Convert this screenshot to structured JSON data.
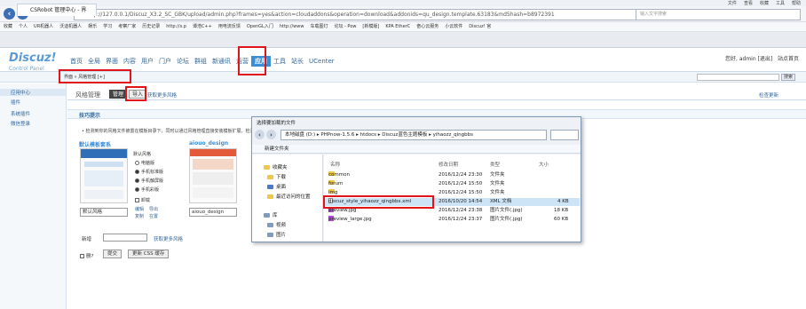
{
  "browser": {
    "menu": [
      "文件",
      "查看",
      "收藏",
      "工具",
      "帮助"
    ],
    "url": "http://127.0.0.1/Discuz_X3.2_SC_GBK/upload/admin.php?frames=yes&action=cloudaddons&operation=download&addonids=qu_design.template.63183&md5hash=b8972391",
    "search_placeholder": "输入文字搜索",
    "bookmarks": [
      "收藏",
      "个人",
      "UR机器人",
      "沃迪机器人",
      "娱乐",
      "学习",
      "考察厂家",
      "历史记录",
      "http://s.p",
      "谭浩C++",
      "用电流反馈",
      "OpenGL入门",
      "http://www",
      "车载图灯",
      "论坛 - Pow",
      "[新模版]",
      "KPA EtherC",
      "奋心云服务",
      "小云软件",
      "Discuz! 官"
    ],
    "tab_title": "CSRobot 管理中心 - 界"
  },
  "header": {
    "logo": "Discuz!",
    "logo_sub": "Control Panel",
    "nav": [
      "首页",
      "全局",
      "界面",
      "内容",
      "用户",
      "门户",
      "论坛",
      "群组",
      "新通讯",
      "运营",
      "应用",
      "工具",
      "站长",
      "UCenter"
    ],
    "active_nav": "应用",
    "user_text": "您好, admin [退出]",
    "site_home": "站点首页"
  },
  "breadcrumb": "界面 » 风格管理 [+]",
  "search_button": "搜索",
  "sidebar": [
    "应用中心",
    "插件",
    "系统插件",
    "微信登录"
  ],
  "main": {
    "title": "风格管理",
    "btn_manage": "管理",
    "btn_import": "导入",
    "more_styles": "获取更多风格",
    "check_new": "检查更新",
    "tip_label": "技巧提示",
    "tip_text": "• 检测到你的风格文件被置在模板目录下，同时以通过风格管理直接安装模板扩展，检测到的风格被置之后，新方式可以在模板扩展",
    "style1": {
      "name": "默认模板套系",
      "field": "默认风格",
      "opt_default": "默认风格",
      "opt1": "电脑版",
      "opt2": "手机标准版",
      "opt3": "手机触屏版",
      "opt4": "手机彩版",
      "cb": "卸载",
      "edit": "编辑",
      "export": "导出",
      "copy": "复制",
      "upgrade": "在置"
    },
    "style2": {
      "name": "aiouo_design",
      "field": "aiouo_design"
    },
    "new_label": "新增",
    "more_link": "获取更多风格",
    "del_label": "删?",
    "submit": "提交",
    "update_css": "更新 CSS 缓存"
  },
  "dialog": {
    "title": "选择要加载的文件",
    "path": "本地磁盘 (D:) ▸ PHPnow-1.5.6 ▸ htdocs ▸ Discuz蓝色主题模板 ▸ yihaozz_qingbbs",
    "new_folder": "新建文件夹",
    "tree": [
      "收藏夹",
      "下载",
      "桌面",
      "最近访问的位置",
      "库",
      "视频",
      "图片"
    ],
    "columns": [
      "名称",
      "修改日期",
      "类型",
      "大小"
    ],
    "files": [
      {
        "name": "common",
        "date": "2016/12/24 23:30",
        "type": "文件夹",
        "size": ""
      },
      {
        "name": "forum",
        "date": "2016/12/24 15:50",
        "type": "文件夹",
        "size": ""
      },
      {
        "name": "img",
        "date": "2016/12/24 15:50",
        "type": "文件夹",
        "size": ""
      },
      {
        "name": "discuz_style_yihaozz_qingbbs.xml",
        "date": "2016/10/20 14:54",
        "type": "XML 文档",
        "size": "4 KB"
      },
      {
        "name": "preview.jpg",
        "date": "2016/12/24 23:38",
        "type": "图片文件(.jpg)",
        "size": "18 KB"
      },
      {
        "name": "preview_large.jpg",
        "date": "2016/12/24 23:37",
        "type": "图片文件(.jpg)",
        "size": "60 KB"
      }
    ]
  }
}
